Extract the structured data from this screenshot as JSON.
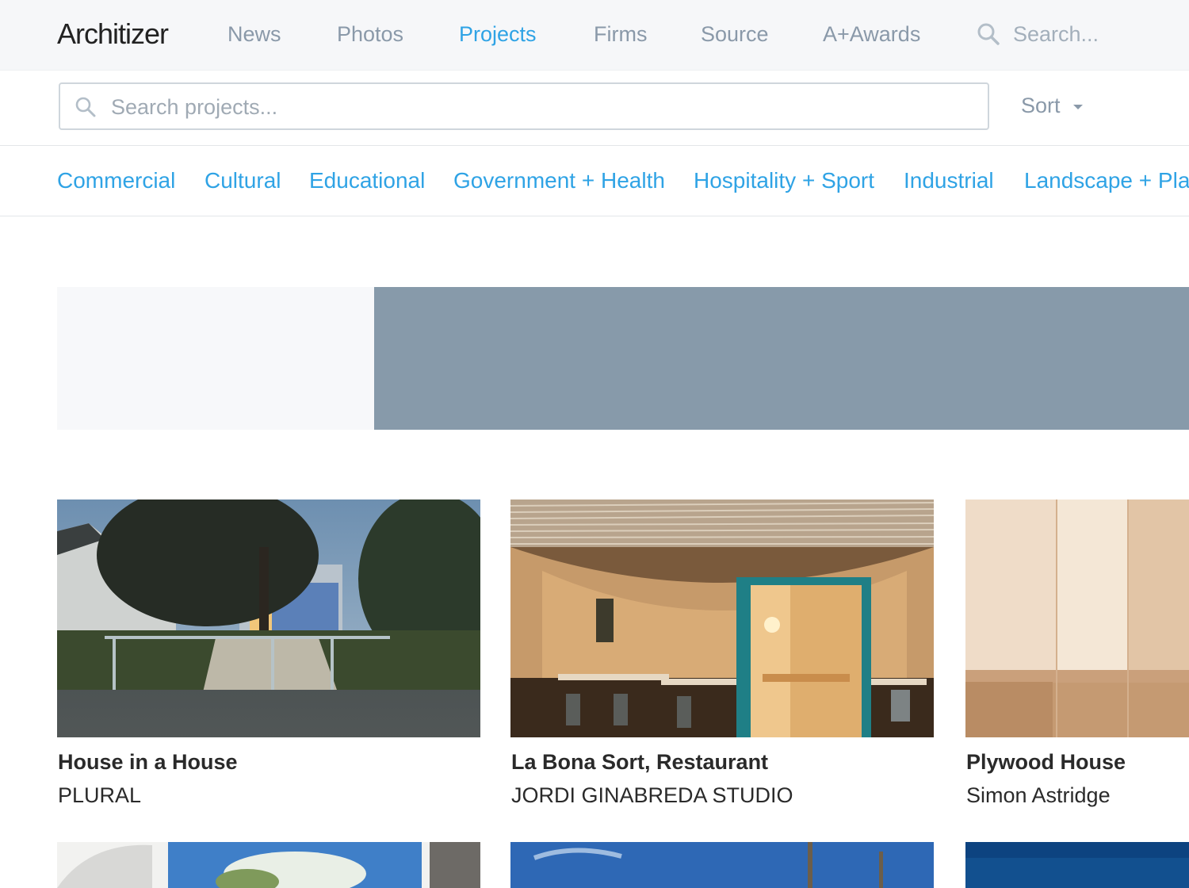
{
  "nav": {
    "logo": "Architizer",
    "links": [
      "News",
      "Photos",
      "Projects",
      "Firms",
      "Source",
      "A+Awards"
    ],
    "active": "Projects",
    "search_placeholder": "Search..."
  },
  "project_search": {
    "placeholder": "Search projects...",
    "sort_label": "Sort"
  },
  "categories": [
    "Commercial",
    "Cultural",
    "Educational",
    "Government + Health",
    "Hospitality + Sport",
    "Industrial",
    "Landscape + Pla"
  ],
  "projects": [
    {
      "title": "House in a House",
      "firm": "PLURAL"
    },
    {
      "title": "La Bona Sort, Restaurant",
      "firm": "JORDI GINABREDA STUDIO"
    },
    {
      "title": "Plywood House",
      "firm": "Simon Astridge"
    }
  ],
  "colors": {
    "accent": "#2fa3e5",
    "nav_text": "#8a99a9",
    "banner": "#879aaa"
  }
}
